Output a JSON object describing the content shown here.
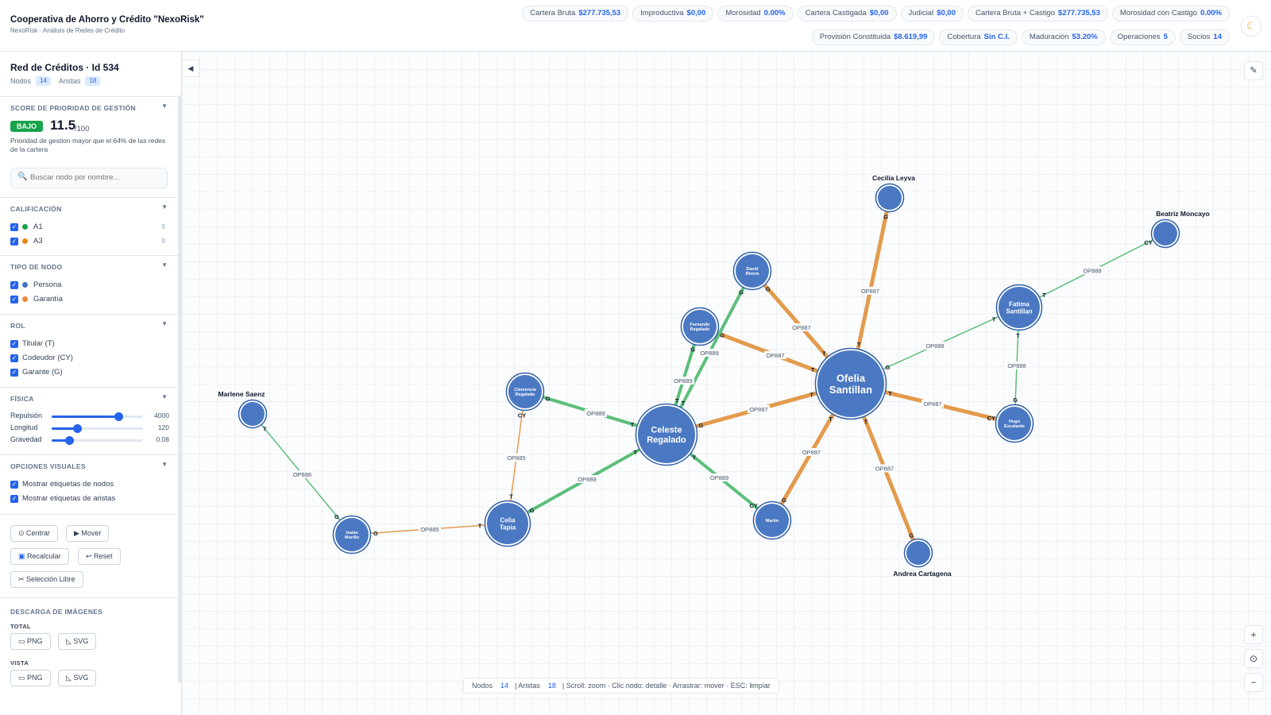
{
  "header": {
    "title": "Cooperativa de Ahorro y Crédito \"NexoRisk\"",
    "subtitle": "NexoRisk · Análisis de Redes de Crédito",
    "metrics_row1": [
      {
        "label": "Cartera Bruta",
        "value": "$277.735,53"
      },
      {
        "label": "Improductiva",
        "value": "$0,00"
      },
      {
        "label": "Morosidad",
        "value": "0.00%"
      },
      {
        "label": "Cartera Castigada",
        "value": "$0,00"
      },
      {
        "label": "Judicial",
        "value": "$0,00"
      },
      {
        "label": "Cartera Bruta + Castigo",
        "value": "$277.735,53"
      },
      {
        "label": "Morosidad con Castigo",
        "value": "0.00%"
      }
    ],
    "metrics_row2": [
      {
        "label": "Provisión Constituida",
        "value": "$8.619,99"
      },
      {
        "label": "Cobertura",
        "value": "Sin C.I."
      },
      {
        "label": "Maduración",
        "value": "53.20%"
      },
      {
        "label": "Operaciones",
        "value": "5"
      },
      {
        "label": "Socios",
        "value": "14"
      }
    ],
    "theme_icon": "moon-icon"
  },
  "sidebar": {
    "network_title": "Red de Créditos · Id 534",
    "nodes_label": "Nodos",
    "nodes_count": "14",
    "edges_label": "Aristas",
    "edges_count": "18",
    "score": {
      "section_title": "SCORE DE PRIORIDAD DE GESTIÓN",
      "badge": "BAJO",
      "badge_color": "#16a34a",
      "value": "11.5",
      "suffix": "/100",
      "description": "Prioridad de gestion mayor que el 64% de las redes de la cartera"
    },
    "search": {
      "placeholder": "Buscar nodo por nombre..."
    },
    "calificacion": {
      "title": "CALIFICACIÓN",
      "items": [
        {
          "label": "A1",
          "color": "#16a34a",
          "count": "9"
        },
        {
          "label": "A3",
          "color": "#ea8a1a",
          "count": "9"
        }
      ]
    },
    "tipo_nodo": {
      "title": "TIPO DE NODO",
      "items": [
        {
          "label": "Persona",
          "color": "#3b74c2"
        },
        {
          "label": "Garantía",
          "color": "#ea8a3a"
        }
      ]
    },
    "rol": {
      "title": "ROL",
      "items": [
        {
          "label": "Titular (T)"
        },
        {
          "label": "Codeudor (CY)"
        },
        {
          "label": "Garante (G)"
        }
      ]
    },
    "fisica": {
      "title": "FÍSICA",
      "sliders": [
        {
          "label": "Repulsión",
          "value": "4000",
          "fraction": 0.73
        },
        {
          "label": "Longitud",
          "value": "120",
          "fraction": 0.28
        },
        {
          "label": "Gravedad",
          "value": "0.08",
          "fraction": 0.19
        }
      ]
    },
    "visual": {
      "title": "OPCIONES VISUALES",
      "items": [
        {
          "label": "Mostrar etiquetas de nodos"
        },
        {
          "label": "Mostrar etiquetas de aristas"
        }
      ]
    },
    "buttons": {
      "center": "Centrar",
      "move": "Mover",
      "recalc": "Recalcular",
      "reset": "Reset",
      "free_select": "Selección Libre"
    },
    "download": {
      "title": "DESCARGA DE IMÁGENES",
      "total": "TOTAL",
      "vista": "VISTA",
      "png": "PNG",
      "svg": "SVG"
    }
  },
  "graph": {
    "colors": {
      "a1": "#5cbf7a",
      "a3": "#e39b4d",
      "node": "#4a78c2"
    },
    "nodes": [
      {
        "id": "celeste",
        "label": "Celeste\nRegalado",
        "size": "xl"
      },
      {
        "id": "ofelia",
        "label": "Ofelia\nSantillan",
        "size": "xxl"
      },
      {
        "id": "cecilia",
        "label": "Cecilia Leyva",
        "size": "s",
        "outside": true
      },
      {
        "id": "beatriz",
        "label": "Beatriz Moncayo",
        "size": "s",
        "outside": true
      },
      {
        "id": "david",
        "label": "David\nRivera",
        "size": "m"
      },
      {
        "id": "fernando",
        "label": "Fernando\nRegalado",
        "size": "m"
      },
      {
        "id": "fatima",
        "label": "Fatima\nSantillan",
        "size": "l"
      },
      {
        "id": "clemencia",
        "label": "Clemencia\nRegalado",
        "size": "m"
      },
      {
        "id": "hugo",
        "label": "Hugo\nEscalante",
        "size": "m"
      },
      {
        "id": "marlene",
        "label": "Marlene Saenz",
        "size": "s",
        "outside": true
      },
      {
        "id": "celia",
        "label": "Celia\nTapia",
        "size": "l"
      },
      {
        "id": "martin",
        "label": "Martin",
        "size": "m"
      },
      {
        "id": "isaias",
        "label": "Isaias\nMurillo",
        "size": "m"
      },
      {
        "id": "andrea",
        "label": "Andrea Cartagena",
        "size": "s",
        "outside": true
      }
    ],
    "edges": [
      {
        "from": "cecilia",
        "to": "ofelia",
        "op": "OP887",
        "from_role": "G",
        "to_role": "T",
        "grade": "a3"
      },
      {
        "from": "david",
        "to": "ofelia",
        "op": "OP887",
        "from_role": "G",
        "to_role": "T",
        "grade": "a3"
      },
      {
        "from": "fernando",
        "to": "ofelia",
        "op": "OP887",
        "from_role": "G",
        "to_role": "T",
        "grade": "a3"
      },
      {
        "from": "celeste",
        "to": "ofelia",
        "op": "OP887",
        "from_role": "G",
        "to_role": "T",
        "grade": "a3"
      },
      {
        "from": "ofelia",
        "to": "hugo",
        "op": "OP887",
        "from_role": "T",
        "to_role": "CY",
        "grade": "a3"
      },
      {
        "from": "ofelia",
        "to": "martin",
        "op": "OP887",
        "from_role": "T",
        "to_role": "G",
        "grade": "a3"
      },
      {
        "from": "ofelia",
        "to": "andrea",
        "op": "OP887",
        "from_role": "T",
        "to_role": "G",
        "grade": "a3"
      },
      {
        "from": "ofelia",
        "to": "fatima",
        "op": "OP888",
        "from_role": "G",
        "to_role": "T",
        "grade": "a1"
      },
      {
        "from": "fatima",
        "to": "beatriz",
        "op": "OP888",
        "from_role": "T",
        "to_role": "CY",
        "grade": "a1"
      },
      {
        "from": "fatima",
        "to": "hugo",
        "op": "OP888",
        "from_role": "T",
        "to_role": "G",
        "grade": "a1"
      },
      {
        "from": "david",
        "to": "celeste",
        "op": "OP889",
        "from_role": "G",
        "to_role": "T",
        "grade": "a1"
      },
      {
        "from": "fernando",
        "to": "celeste",
        "op": "OP889",
        "from_role": "G",
        "to_role": "T",
        "grade": "a1"
      },
      {
        "from": "clemencia",
        "to": "celeste",
        "op": "OP889",
        "from_role": "G",
        "to_role": "T",
        "grade": "a1"
      },
      {
        "from": "celeste",
        "to": "martin",
        "op": "OP889",
        "from_role": "T",
        "to_role": "CY",
        "grade": "a1"
      },
      {
        "from": "celia",
        "to": "celeste",
        "op": "OP889",
        "from_role": "G",
        "to_role": "T",
        "grade": "a1"
      },
      {
        "from": "clemencia",
        "to": "celia",
        "op": "OP885",
        "from_role": "CY",
        "to_role": "T",
        "grade": "a3"
      },
      {
        "from": "isaias",
        "to": "celia",
        "op": "OP885",
        "from_role": "G",
        "to_role": "T",
        "grade": "a3"
      },
      {
        "from": "marlene",
        "to": "isaias",
        "op": "OP886",
        "from_role": "T",
        "to_role": "G",
        "grade": "a1"
      }
    ]
  },
  "status": {
    "nodes_label": "Nodos",
    "nodes_count": "14",
    "edges_label": "| Aristas",
    "edges_count": "18",
    "hint": "| Scroll: zoom · Clic nodo: detalle · Arrastrar: mover · ESC: limpiar"
  },
  "canvas_controls": {
    "collapse_icon": "chevron-left-icon",
    "edit_icon": "pencil-icon",
    "zoom_in": "+",
    "zoom_fit": "⊙",
    "zoom_out": "−"
  }
}
